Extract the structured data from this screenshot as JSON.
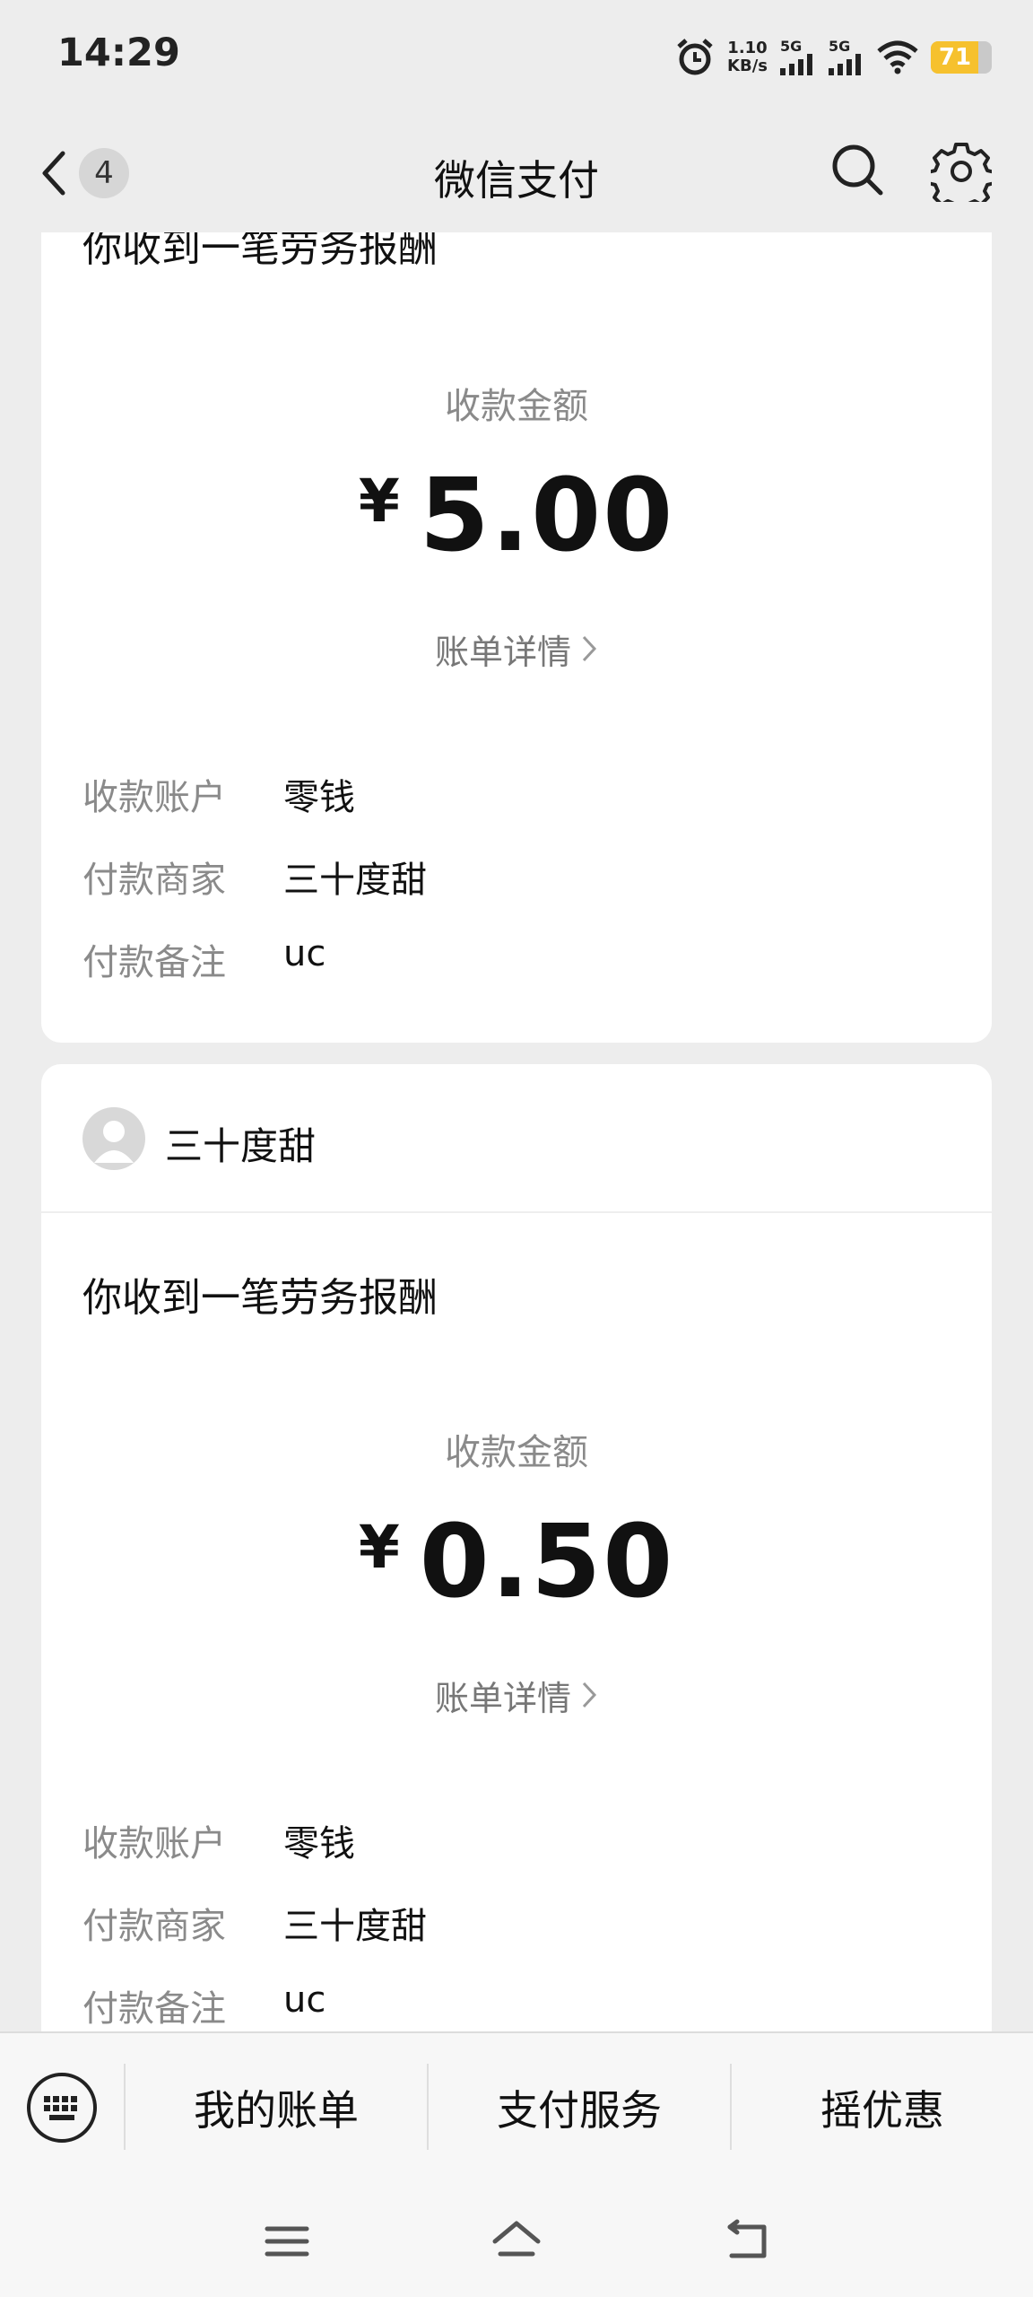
{
  "status_bar": {
    "time": "14:29",
    "net_speed_value": "1.10",
    "net_speed_unit": "KB/s",
    "sim1": "5G",
    "sim2": "5G",
    "battery": "71"
  },
  "header": {
    "back_badge": "4",
    "title": "微信支付"
  },
  "cards": [
    {
      "title": "你收到一笔劳务报酬",
      "amount_label": "收款金额",
      "currency": "¥",
      "amount": "5.00",
      "detail_link": "账单详情",
      "rows": [
        {
          "key": "收款账户",
          "value": "零钱"
        },
        {
          "key": "付款商家",
          "value": "三十度甜"
        },
        {
          "key": "付款备注",
          "value": "uc"
        }
      ]
    },
    {
      "sender": "三十度甜",
      "title": "你收到一笔劳务报酬",
      "amount_label": "收款金额",
      "currency": "¥",
      "amount": "0.50",
      "detail_link": "账单详情",
      "rows": [
        {
          "key": "收款账户",
          "value": "零钱"
        },
        {
          "key": "付款商家",
          "value": "三十度甜"
        },
        {
          "key": "付款备注",
          "value": "uc"
        }
      ]
    }
  ],
  "bottom_menu": {
    "items": [
      "我的账单",
      "支付服务",
      "摇优惠"
    ]
  },
  "icons": {
    "back": "chevron-left-icon",
    "search": "search-icon",
    "settings": "gear-icon",
    "keyboard": "keyboard-icon",
    "nav_menu": "menu-icon",
    "nav_home": "home-icon",
    "nav_back": "back-icon"
  },
  "colors": {
    "battery": "#f6c12e",
    "background": "#ededed",
    "card": "#ffffff"
  }
}
